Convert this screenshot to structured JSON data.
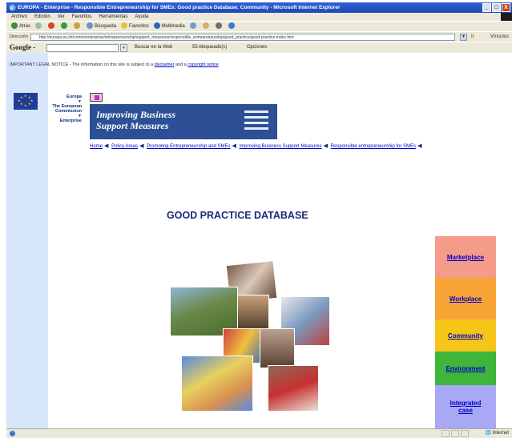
{
  "window": {
    "title": "EUROPA - Enterprise - Responsible Entrepreneurship for SMEs: Good practice Database: Community - Microsoft Internet Explorer",
    "controls": [
      "_",
      "□",
      "X"
    ]
  },
  "menubar": {
    "items": [
      "Archivo",
      "Edición",
      "Ver",
      "Favoritos",
      "Herramientas",
      "Ayuda"
    ]
  },
  "toolbar": {
    "back": "Atrás",
    "search": "Búsqueda",
    "favorites": "Favoritos",
    "multimedia": "Multimedia"
  },
  "addressbar": {
    "label": "Dirección",
    "url": "http://europa.eu.int/comm/enterprise/entrepreneurship/support_measures/responsible_entrepreneurship/good_practice/good-practice-index.htm",
    "go": "Ir",
    "links": "Vínculos"
  },
  "googlebar": {
    "logo": "Google -",
    "search_web": "Buscar en la Web",
    "blocked": "55 bloqueado(s)",
    "options": "Opciones"
  },
  "notice": {
    "prefix": "IMPORTANT LEGAL NOTICE - The information on this site is subject to a",
    "link1": "disclaimer",
    "middle": "and a",
    "link2": "copyright notice"
  },
  "nav_left": {
    "europa": "Europa",
    "commission_line1": "The European",
    "commission_line2": "Commission",
    "enterprise": "Enterprise"
  },
  "banner": {
    "line1": "Improving Business",
    "line2": "Support Measures"
  },
  "breadcrumb": {
    "items": [
      "Home",
      "Policy Areas",
      "Promoting Entrepreneurship and SMEs",
      "Improving Business Support Measures",
      "Responsible entrepreneurship for SMEs"
    ]
  },
  "heading": "GOOD PRACTICE DATABASE",
  "side_nav": {
    "items": [
      {
        "label": "Marketplace",
        "color": "#f59b8a"
      },
      {
        "label": "Workplace",
        "color": "#f7a436"
      },
      {
        "label": "Community",
        "color": "#f5c518"
      },
      {
        "label": "Environment",
        "color": "#3fb53a"
      },
      {
        "label": "Integrated case",
        "color": "#a8a8f5"
      }
    ]
  },
  "statusbar": {
    "zone": "Internet"
  }
}
